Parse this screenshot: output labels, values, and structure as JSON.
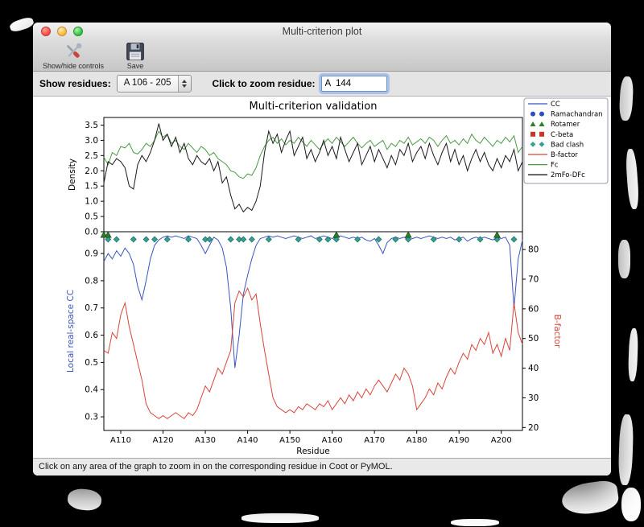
{
  "window": {
    "title": "Multi-criterion plot",
    "toolbar": {
      "show_hide_label": "Show/hide controls",
      "save_label": "Save"
    },
    "controls": {
      "show_residues_label": "Show residues:",
      "residue_range_value": "A 106 - 205",
      "zoom_label": "Click to zoom residue:",
      "zoom_value": "A  144"
    },
    "status_text": "Click on any area of the graph to zoom in on the corresponding residue in Coot or PyMOL."
  },
  "chart_data": {
    "type": "line",
    "title": "Multi-criterion validation",
    "x_label": "Residue",
    "residue_range": [
      106,
      205
    ],
    "x_ticks": [
      {
        "residue": 110,
        "label": "A110"
      },
      {
        "residue": 120,
        "label": "A120"
      },
      {
        "residue": 130,
        "label": "A130"
      },
      {
        "residue": 140,
        "label": "A140"
      },
      {
        "residue": 150,
        "label": "A150"
      },
      {
        "residue": 160,
        "label": "A160"
      },
      {
        "residue": 170,
        "label": "A170"
      },
      {
        "residue": 180,
        "label": "A180"
      },
      {
        "residue": 190,
        "label": "A190"
      },
      {
        "residue": 200,
        "label": "A200"
      }
    ],
    "colors": {
      "cc": "#3a55c0",
      "b_factor": "#d8453b",
      "fc": "#4a9a44",
      "two_mfo_dfc": "#1a1a1a",
      "bad_clash": "#35a193",
      "rotamer": "#2e7d2e",
      "ramachandran": "#2f4bc1",
      "c_beta": "#c8372d"
    },
    "top_plot": {
      "y_label": "Density",
      "ylim": [
        0,
        3.75
      ],
      "yticks": [
        0.0,
        0.5,
        1.0,
        1.5,
        2.0,
        2.5,
        3.0,
        3.5
      ],
      "series": [
        {
          "name": "Fc",
          "color": "#4a9a44",
          "values": [
            2.45,
            2.2,
            2.6,
            2.5,
            2.8,
            2.75,
            2.9,
            2.6,
            2.55,
            2.7,
            2.9,
            2.8,
            3.0,
            3.3,
            3.1,
            3.2,
            2.9,
            3.0,
            2.8,
            2.7,
            2.9,
            2.75,
            2.6,
            2.8,
            2.7,
            2.5,
            2.6,
            2.4,
            2.3,
            2.2,
            2.0,
            1.95,
            1.8,
            1.75,
            1.9,
            1.85,
            2.1,
            2.5,
            2.8,
            3.0,
            3.1,
            2.9,
            3.05,
            2.85,
            3.0,
            2.9,
            3.1,
            2.95,
            2.8,
            3.0,
            2.85,
            2.7,
            2.9,
            3.05,
            2.9,
            3.1,
            2.95,
            2.8,
            2.95,
            3.1,
            2.9,
            2.75,
            2.9,
            3.0,
            2.8,
            2.9,
            3.0,
            2.7,
            2.9,
            2.8,
            3.0,
            2.9,
            3.1,
            2.85,
            2.95,
            3.05,
            2.9,
            3.1,
            3.0,
            2.8,
            3.0,
            3.15,
            2.9,
            3.0,
            2.85,
            3.05,
            2.9,
            3.2,
            3.0,
            2.9,
            3.1,
            2.95,
            2.8,
            3.0,
            2.9,
            3.1,
            2.95,
            3.15,
            2.6,
            2.8
          ]
        },
        {
          "name": "2mFo-DFc",
          "color": "#1a1a1a",
          "values": [
            1.6,
            2.3,
            2.2,
            2.4,
            2.3,
            2.1,
            1.5,
            1.4,
            2.2,
            2.5,
            2.3,
            2.6,
            3.0,
            3.55,
            3.0,
            3.2,
            2.8,
            3.1,
            2.6,
            2.9,
            2.4,
            2.2,
            2.5,
            2.3,
            2.2,
            2.4,
            2.0,
            2.3,
            1.6,
            1.8,
            1.2,
            0.75,
            0.9,
            0.65,
            0.8,
            0.7,
            1.0,
            1.5,
            2.6,
            3.3,
            2.9,
            3.2,
            2.6,
            3.0,
            3.3,
            2.5,
            2.8,
            3.1,
            2.4,
            2.7,
            2.3,
            2.6,
            3.0,
            2.5,
            2.8,
            2.4,
            3.1,
            2.7,
            2.3,
            2.6,
            2.9,
            2.2,
            2.5,
            2.8,
            2.3,
            2.7,
            2.4,
            2.1,
            2.5,
            2.2,
            2.7,
            2.5,
            2.9,
            2.3,
            2.6,
            2.8,
            2.4,
            2.9,
            2.5,
            2.2,
            2.6,
            2.9,
            2.3,
            2.7,
            2.2,
            2.5,
            2.0,
            2.4,
            2.7,
            2.3,
            2.6,
            2.2,
            2.0,
            2.4,
            2.1,
            2.5,
            2.3,
            2.7,
            2.0,
            2.3
          ]
        }
      ]
    },
    "bottom_plot": {
      "y_left_label": "Local real-space CC",
      "y_left_lim": [
        0.25,
        0.98
      ],
      "y_left_ticks": [
        0.3,
        0.4,
        0.5,
        0.6,
        0.7,
        0.8,
        0.9
      ],
      "y_right_label": "B-factor",
      "y_right_lim": [
        19,
        86
      ],
      "y_right_ticks": [
        20,
        30,
        40,
        50,
        60,
        70,
        80
      ],
      "cc_values": [
        0.87,
        0.9,
        0.88,
        0.91,
        0.89,
        0.92,
        0.9,
        0.86,
        0.78,
        0.73,
        0.8,
        0.88,
        0.93,
        0.95,
        0.96,
        0.965,
        0.96,
        0.965,
        0.96,
        0.955,
        0.965,
        0.96,
        0.955,
        0.93,
        0.9,
        0.93,
        0.96,
        0.95,
        0.92,
        0.85,
        0.7,
        0.48,
        0.6,
        0.75,
        0.82,
        0.88,
        0.93,
        0.955,
        0.96,
        0.965,
        0.96,
        0.965,
        0.96,
        0.955,
        0.96,
        0.965,
        0.96,
        0.955,
        0.96,
        0.965,
        0.955,
        0.96,
        0.965,
        0.96,
        0.955,
        0.96,
        0.965,
        0.96,
        0.955,
        0.96,
        0.955,
        0.96,
        0.95,
        0.945,
        0.955,
        0.93,
        0.9,
        0.94,
        0.955,
        0.96,
        0.955,
        0.96,
        0.95,
        0.955,
        0.96,
        0.955,
        0.96,
        0.965,
        0.96,
        0.955,
        0.96,
        0.955,
        0.96,
        0.95,
        0.955,
        0.96,
        0.945,
        0.955,
        0.96,
        0.955,
        0.96,
        0.955,
        0.95,
        0.96,
        0.955,
        0.96,
        0.93,
        0.7,
        0.88,
        0.95
      ],
      "b_factor_values": [
        46,
        45,
        52,
        50,
        58,
        62,
        54,
        48,
        42,
        36,
        28,
        25,
        24,
        23,
        24,
        23,
        24,
        25,
        24,
        23,
        25,
        24,
        26,
        30,
        34,
        32,
        36,
        40,
        38,
        42,
        46,
        62,
        66,
        64,
        67,
        63,
        65,
        55,
        46,
        38,
        30,
        27,
        26,
        25,
        26,
        25,
        27,
        26,
        28,
        27,
        26,
        28,
        27,
        29,
        26,
        28,
        30,
        28,
        31,
        29,
        32,
        30,
        33,
        31,
        34,
        36,
        34,
        32,
        35,
        38,
        36,
        40,
        38,
        34,
        26,
        28,
        30,
        33,
        31,
        35,
        33,
        37,
        40,
        38,
        42,
        45,
        43,
        48,
        46,
        50,
        48,
        52,
        45,
        48,
        44,
        50,
        46,
        62,
        52,
        48
      ],
      "markers": {
        "bad_clash_y": 0.952,
        "bad_clash_residues": [
          107,
          109,
          113,
          116,
          118,
          121,
          126,
          130,
          131,
          136,
          138,
          139,
          141,
          145,
          152,
          157,
          159,
          161,
          166,
          171,
          175,
          178,
          184,
          190,
          195,
          199,
          203
        ],
        "rotamer_y": 0.968,
        "rotamer_residues": [
          106,
          107,
          161,
          178,
          199
        ],
        "ramachandran_residues": [],
        "c_beta_residues": []
      }
    },
    "legend": [
      {
        "label": "CC",
        "swatch": "line",
        "color": "#3a55c0"
      },
      {
        "label": "Ramachandran",
        "swatch": "circles",
        "color": "#2f4bc1"
      },
      {
        "label": "Rotamer",
        "swatch": "triangles",
        "color": "#2e7d2e"
      },
      {
        "label": "C-beta",
        "swatch": "squares",
        "color": "#c8372d"
      },
      {
        "label": "Bad clash",
        "swatch": "diamonds",
        "color": "#35a193"
      },
      {
        "label": "B-factor",
        "swatch": "line",
        "color": "#d8453b"
      },
      {
        "label": "Fc",
        "swatch": "line",
        "color": "#4a9a44"
      },
      {
        "label": "2mFo-DFc",
        "swatch": "line",
        "color": "#1a1a1a"
      }
    ]
  }
}
